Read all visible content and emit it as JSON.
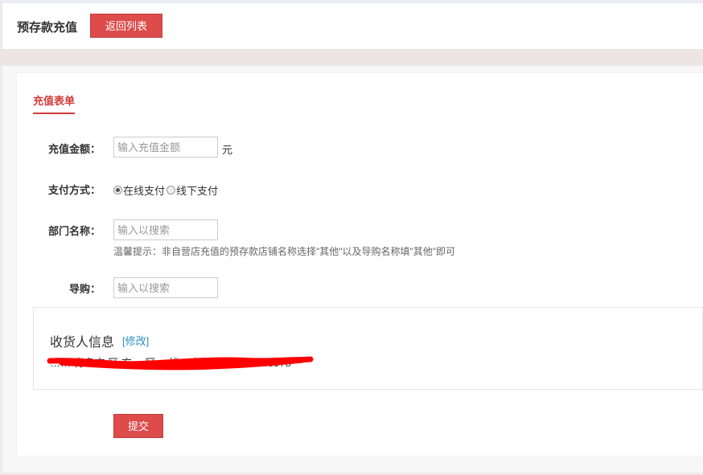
{
  "header": {
    "title": "预存款充值",
    "back_label": "返回列表"
  },
  "form": {
    "section_title": "充值表单",
    "amount": {
      "label": "充值金额：",
      "placeholder": "输入充值金额",
      "value": "",
      "unit": "元"
    },
    "payment": {
      "label": "支付方式：",
      "options": [
        {
          "label": "在线支付",
          "selected": true
        },
        {
          "label": "线下支付",
          "selected": false
        }
      ]
    },
    "department": {
      "label": "部门名称：",
      "placeholder": "输入以搜索",
      "value": "",
      "hint": "温馨提示：非自营店充值的预存款店铺名称选择\"其他\"以及导购名称填\"其他\"即可"
    },
    "guide": {
      "label": "导购：",
      "placeholder": "输入以搜索",
      "value": ""
    },
    "receiver": {
      "title": "收货人信息",
      "edit_label": "[修改]",
      "info": "…… 青岛市 区 方… 区… 忧…大龙 邵   17702948578"
    },
    "submit_label": "提交"
  },
  "colors": {
    "accent": "#dd4b4b",
    "link": "#2a8fbd",
    "redaction": "#ff0000"
  }
}
